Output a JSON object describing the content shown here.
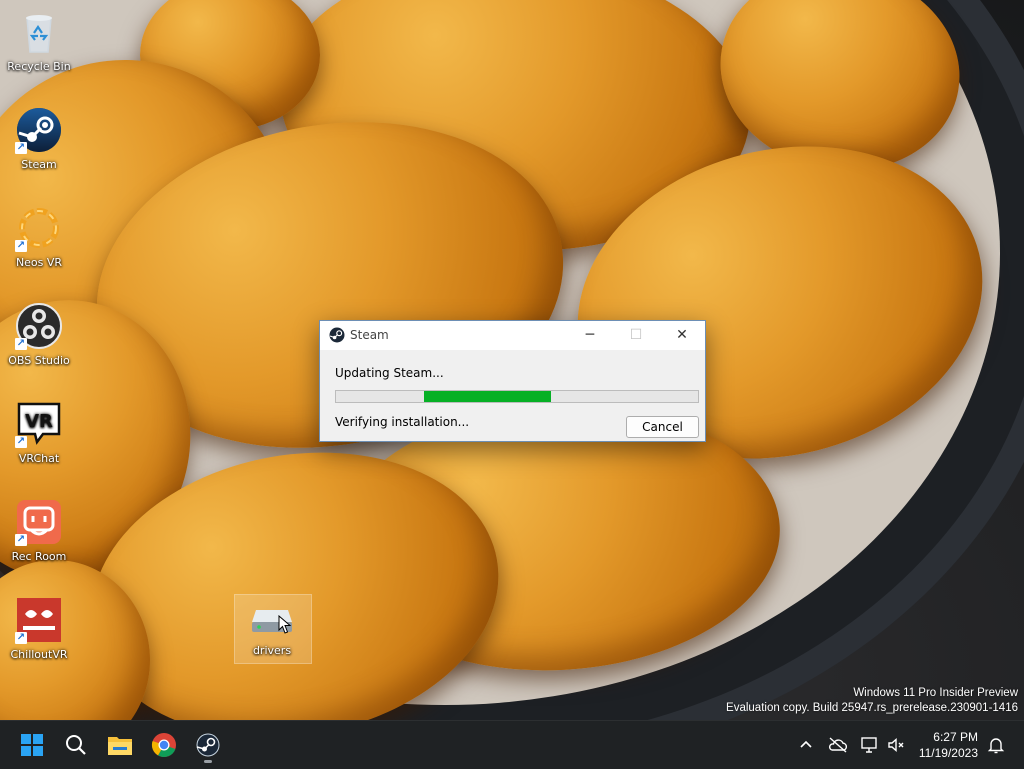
{
  "desktop": {
    "icons": [
      {
        "label": "Recycle Bin",
        "icon": "recycle-bin-icon"
      },
      {
        "label": "Steam",
        "icon": "steam-icon"
      },
      {
        "label": "Neos VR",
        "icon": "neos-vr-icon"
      },
      {
        "label": "OBS Studio",
        "icon": "obs-studio-icon"
      },
      {
        "label": "VRChat",
        "icon": "vrchat-icon"
      },
      {
        "label": "Rec Room",
        "icon": "rec-room-icon"
      },
      {
        "label": "ChilloutVR",
        "icon": "chilloutvr-icon"
      },
      {
        "label": "drivers",
        "icon": "drive-icon"
      }
    ],
    "vrchat_logo_text": "VR"
  },
  "dialog": {
    "title": "Steam",
    "status": "Updating Steam...",
    "progress_bar_fill_percent": 35,
    "detail": "Verifying installation...",
    "cancel_label": "Cancel",
    "minimize_icon": "minimize-icon",
    "maximize_icon": "maximize-icon",
    "close_icon": "close-icon",
    "progress_color": "#06b025"
  },
  "watermark": {
    "line1": "Windows 11 Pro Insider Preview",
    "line2": "Evaluation copy. Build 25947.rs_prerelease.230901-1416"
  },
  "taskbar": {
    "pinned": [
      {
        "name": "start-button",
        "icon": "windows-logo-icon"
      },
      {
        "name": "search-button",
        "icon": "search-icon"
      },
      {
        "name": "file-explorer-button",
        "icon": "folder-icon"
      },
      {
        "name": "chrome-button",
        "icon": "chrome-icon"
      },
      {
        "name": "steam-taskbar-button",
        "icon": "steam-icon"
      }
    ],
    "tray": {
      "overflow_icon": "chevron-up-icon",
      "onedrive_icon": "cloud-offline-icon",
      "network_icon": "network-icon",
      "volume_icon": "volume-muted-icon",
      "notification_icon": "bell-icon"
    },
    "clock": {
      "time": "6:27 PM",
      "date": "11/19/2023"
    }
  },
  "colors": {
    "taskbar_bg": "#1f2224",
    "accent": "#0078d4",
    "steam_blue": "#1b2838"
  }
}
